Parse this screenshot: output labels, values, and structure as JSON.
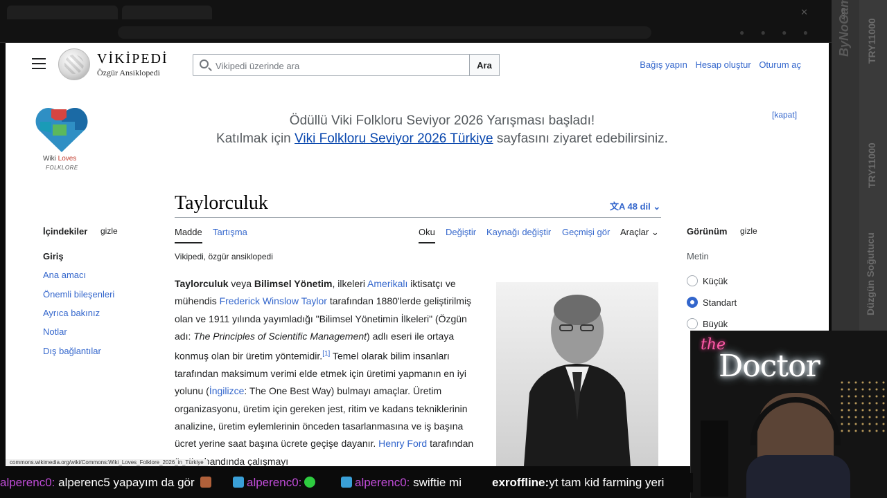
{
  "side_overlay": {
    "brand": "ByNoGame",
    "brand_suffix": ".com",
    "code1": "TRY11000",
    "code2": "TRY11000",
    "sponsor": "Düzgün Soğutucu"
  },
  "header": {
    "logo_word": "VİKİPEDİ",
    "logo_tagline": "Özgür Ansiklopedi",
    "search_placeholder": "Vikipedi üzerinde ara",
    "search_button": "Ara",
    "user_links": [
      "Bağış yapın",
      "Hesap oluştur",
      "Oturum aç"
    ]
  },
  "banner": {
    "logo_text_a": "Wiki",
    "logo_text_b": "Loves",
    "logo_text_c": "FOLKLORE",
    "line1": "Ödüllü Viki Folkloru Seviyor 2026 Yarışması başladı!",
    "line2_pre": "Katılmak için",
    "line2_link": "Viki Folkloru Seviyor 2026 Türkiye",
    "line2_post": "sayfasını ziyaret edebilirsiniz.",
    "close": "[kapat]"
  },
  "article": {
    "title": "Taylorculuk",
    "languages": "48 dil",
    "tabs_left": [
      "Madde",
      "Tartışma"
    ],
    "tabs_right": [
      "Oku",
      "Değiştir",
      "Kaynağı değiştir",
      "Geçmişi gör",
      "Araçlar"
    ],
    "tagline": "Vikipedi, özgür ansiklopedi",
    "p1": "Taylorculuk",
    "p2": " veya ",
    "p3": "Bilimsel Yönetim",
    "p4": ", ilkeleri ",
    "p5": "Amerikalı",
    "p6": " iktisatçı ve mühendis ",
    "p7": "Frederick Winslow Taylor",
    "p8": " tarafından 1880'lerde geliştirilmiş olan ve 1911 yılında yayımladığı \"Bilimsel Yönetimin İlkeleri\" (Özgün adı: ",
    "p9": "The Principles of Scientific Management",
    "p10": ") adlı eseri ile ortaya konmuş olan bir üretim yöntemidir.",
    "p11": "[1]",
    "p12": " Temel olarak bilim insanları tarafından maksimum verimi elde etmek için üretimi yapmanın en iyi yolunu (",
    "p13": "İngilizce",
    "p14": ": The One Best Way) bulmayı amaçlar. Üretim organizasyonu, üretim için gereken jest, ritim ve kadans tekniklerinin analizine, üretim eylemlerinin önceden tasarlanmasına ve iş başına ücret yerine saat başına ücrete geçişe dayanır. ",
    "p15": "Henry Ford",
    "p16": " tarafından üretim bandında çalışmayı"
  },
  "toc": {
    "heading": "İçindekiler",
    "hide": "gizle",
    "items": [
      "Giriş",
      "Ana amacı",
      "Önemli bileşenleri",
      "Ayrıca bakınız",
      "Notlar",
      "Dış bağlantılar"
    ]
  },
  "appearance": {
    "heading": "Görünüm",
    "hide": "gizle",
    "text_label": "Metin",
    "options": [
      "Küçük",
      "Standart",
      "Büyük"
    ],
    "selected": "Standart"
  },
  "status_url": "commons.wikimedia.org/wiki/Commons:Wiki_Loves_Folklore_2026_in_Türkiye",
  "webcam": {
    "sign_small": "the",
    "sign_big": "Doctor"
  },
  "chat": {
    "m1_user": "alperenc0:",
    "m1_text": " alperenc5 yapayım da gör ",
    "m2_user": "alperenc0:",
    "m3_user": "alperenc0:",
    "m3_text": " swiftie mi ",
    "m4_user": "exroffline:",
    "m4_text": "yt tam kid farming yeri"
  },
  "colors": {
    "link": "#3366cc",
    "chat_user": "#c04cd8",
    "neon_pink": "#ff5aa8"
  }
}
